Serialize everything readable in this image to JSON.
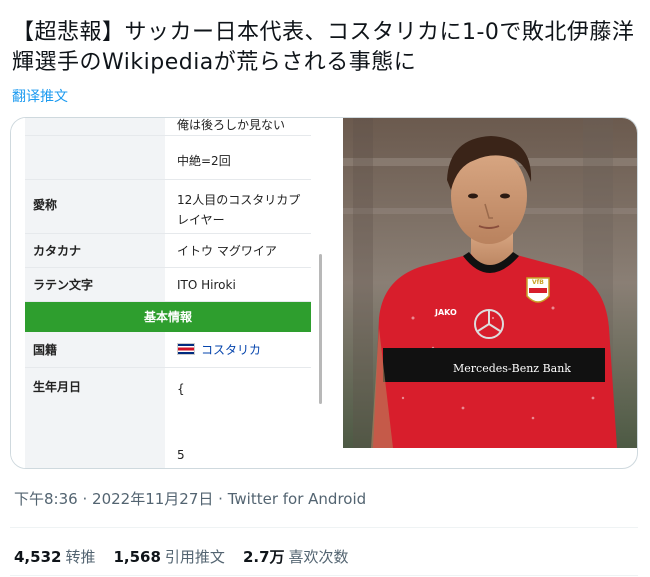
{
  "tweet": {
    "text": "【超悲報】サッカー日本代表、コスタリカに1-0で敗北伊藤洋輝選手のWikipediaが荒らされる事態に",
    "translate_label": "翻译推文"
  },
  "infobox": {
    "rows_top": [
      {
        "key": "",
        "value": "俺は後ろしか見ない"
      },
      {
        "key": "",
        "value": "中絶=2回"
      },
      {
        "key": "愛称",
        "value": "12人目のコスタリカプレイヤー"
      },
      {
        "key": "カタカナ",
        "value": "イトウ マグワイア"
      },
      {
        "key": "ラテン文字",
        "value": "ITO Hiroki"
      }
    ],
    "section_header": "基本情報",
    "nationality_key": "国籍",
    "nationality_value": "コスタリカ",
    "birth_key": "生年月日",
    "birth_value_1": "{",
    "birth_value_2": "5"
  },
  "photo": {
    "jersey_sponsor": "Mercedes-Benz Bank",
    "jersey_brand": "JAKO",
    "badge_text": "VfB"
  },
  "meta": {
    "time": "下午8:36",
    "separator": "·",
    "date": "2022年11月27日",
    "source": "Twitter for Android"
  },
  "stats": [
    {
      "num": "4,532",
      "label": "转推"
    },
    {
      "num": "1,568",
      "label": "引用推文"
    },
    {
      "num": "2.7万",
      "label": "喜欢次数"
    }
  ],
  "colors": {
    "link_blue": "#1d9bf0",
    "wiki_green": "#2e9e2e",
    "jersey_red": "#d81e2c"
  }
}
